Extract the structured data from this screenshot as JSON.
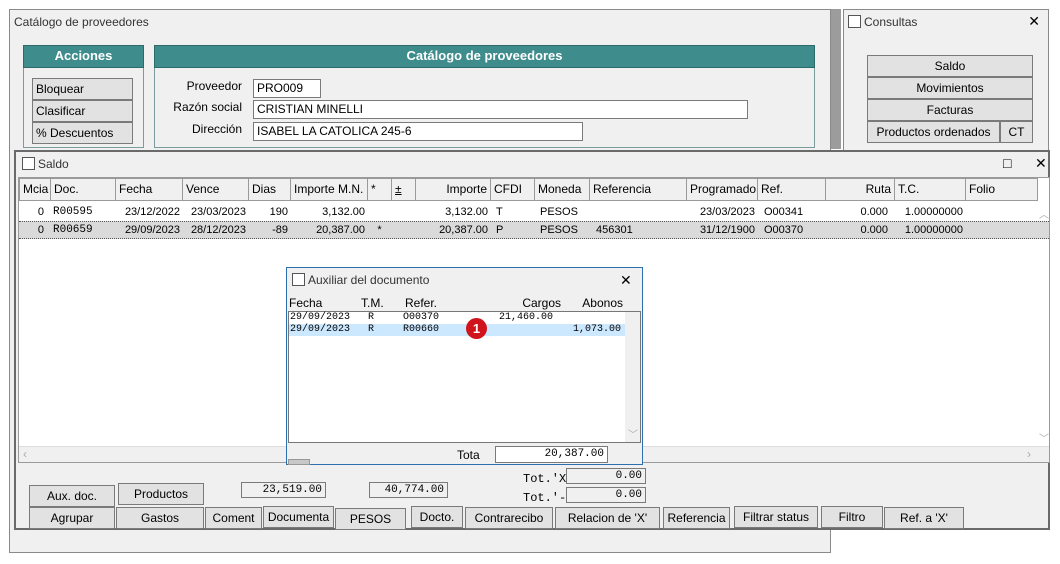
{
  "catalog_window": {
    "title": "Catálogo de proveedores",
    "actions_header": "Acciones",
    "form_header": "Catálogo de proveedores",
    "actions": [
      "Bloquear",
      "Clasificar",
      "% Descuentos"
    ],
    "proveedor_label": "Proveedor",
    "proveedor_value": "PRO009",
    "razon_label": "Razón social",
    "razon_value": "CRISTIAN MINELLI",
    "direccion_label": "Dirección",
    "direccion_value": "ISABEL LA CATOLICA 245-6"
  },
  "consultas_window": {
    "title": "Consultas",
    "buttons": [
      "Saldo",
      "Movimientos",
      "Facturas",
      "Productos ordenados",
      "CT"
    ]
  },
  "saldo_window": {
    "title": "Saldo",
    "columns": [
      "Mcia",
      "Doc.",
      "Fecha",
      "Vence",
      "Dias",
      "Importe M.N.",
      "*",
      "±",
      "Importe",
      "CFDI",
      "Moneda",
      "Referencia",
      "Programado",
      "Ref.",
      "Ruta",
      "T.C.",
      "Folio"
    ],
    "rows": [
      [
        "0",
        "R00595",
        "23/12/2022",
        "23/03/2023",
        "190",
        "3,132.00",
        "",
        "",
        "3,132.00",
        "T",
        "PESOS",
        "",
        "23/03/2023",
        "O00341",
        "0.000",
        "1.00000000",
        ""
      ],
      [
        "0",
        "R00659",
        "29/09/2023",
        "28/12/2023",
        "-89",
        "20,387.00",
        "*",
        "",
        "20,387.00",
        "P",
        "PESOS",
        "456301",
        "31/12/1900",
        "O00370",
        "0.000",
        "1.00000000",
        ""
      ]
    ],
    "totals": {
      "total1": "23,519.00",
      "total2": "40,774.00",
      "tot_x_label": "Tot.'X",
      "tot_x_value": "0.00",
      "tot_dash_label": "Tot.'-",
      "tot_dash_value": "0.00"
    },
    "bottom_buttons_row1": [
      "Aux. doc.",
      "Productos"
    ],
    "bottom_buttons_row2": [
      "Agrupar",
      "Gastos",
      "Coment",
      "Documenta",
      "PESOS",
      "Docto.",
      "Contrarecibo",
      "Relacion de 'X'",
      "Referencia",
      "Filtrar status",
      "Filtro",
      "Ref. a 'X'"
    ]
  },
  "aux_window": {
    "title": "Auxiliar del documento",
    "columns": [
      "Fecha",
      "T.M.",
      "Refer.",
      "Cargos",
      "Abonos"
    ],
    "rows": [
      [
        "29/09/2023",
        "R",
        "O00370",
        "21,460.00",
        ""
      ],
      [
        "29/09/2023",
        "R",
        "R00660",
        "",
        "1,073.00"
      ]
    ],
    "badge": "1",
    "total_label": "Tota",
    "total_value": "20,387.00"
  },
  "colors": {
    "teal_header": "#3f8c8c",
    "selection": "#cce8ff",
    "badge_red": "#d0141b"
  }
}
